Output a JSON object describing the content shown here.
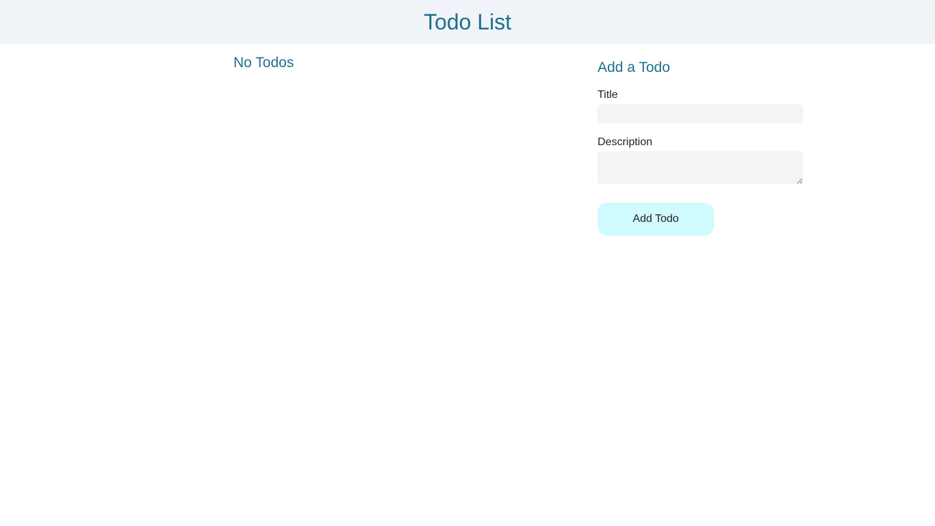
{
  "header": {
    "title": "Todo List"
  },
  "todos": {
    "empty_message": "No Todos",
    "items": []
  },
  "form": {
    "heading": "Add a Todo",
    "title_label": "Title",
    "title_value": "",
    "description_label": "Description",
    "description_value": "",
    "submit_label": "Add Todo"
  },
  "colors": {
    "header_bg": "#f0f4f8",
    "accent_text": "#1f6f8b",
    "input_bg": "#f3f4f6",
    "button_bg": "#cffafe"
  }
}
